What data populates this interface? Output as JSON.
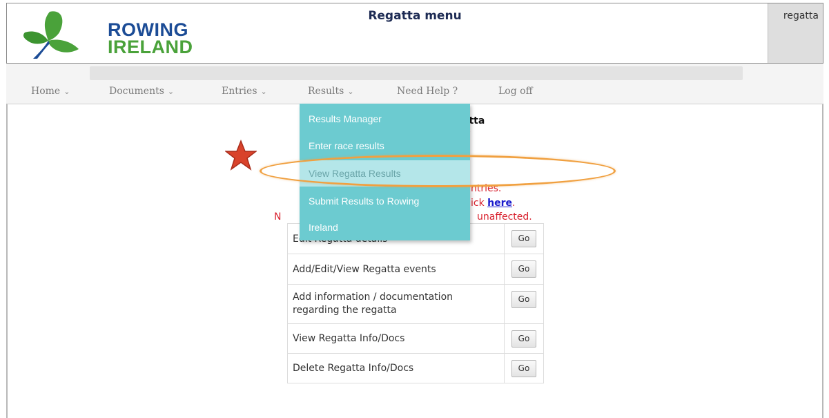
{
  "brand": {
    "line1": "ROWING",
    "line2": "IRELAND"
  },
  "header": {
    "title": "Regatta menu",
    "user": "regatta"
  },
  "nav": [
    {
      "label": "Home",
      "chevron": "⌄"
    },
    {
      "label": "Documents",
      "chevron": "⌄"
    },
    {
      "label": "Entries",
      "chevron": "⌄"
    },
    {
      "label": "Results",
      "chevron": "⌄"
    },
    {
      "label": "Need Help ?"
    },
    {
      "label": "Log off"
    }
  ],
  "dropdown": {
    "items": [
      {
        "label": "Results Manager"
      },
      {
        "label": "Enter race results"
      },
      {
        "label": "View Regatta Results"
      },
      {
        "label": "Submit Results to Rowing"
      },
      {
        "label": "Ireland"
      }
    ]
  },
  "main": {
    "title_fragment1": "gatta",
    "title_fragment2": "/",
    "red_line1": "ntries.",
    "red_line2_prefix": "ick ",
    "red_line2_link": "here",
    "red_line2_suffix": ".",
    "red_line3_prefix": "N",
    "red_line3_suffix": "unaffected."
  },
  "actions": {
    "rows": [
      {
        "label": "Edit Regatta details",
        "button": "Go"
      },
      {
        "label": "Add/Edit/View Regatta events",
        "button": "Go"
      },
      {
        "label": "Add information / documentation regarding the regatta",
        "button": "Go"
      },
      {
        "label": "View Regatta Info/Docs",
        "button": "Go"
      },
      {
        "label": "Delete Regatta Info/Docs",
        "button": "Go"
      }
    ]
  },
  "colors": {
    "brand_blue": "#1c4c96",
    "brand_green": "#4aa23a",
    "dropdown_bg": "#6ccbd0",
    "dropdown_highlight": "#b4e6e9",
    "annotation_orange": "#f0a040",
    "annotation_star": "#d9432b",
    "warning_red": "#d8212e"
  }
}
